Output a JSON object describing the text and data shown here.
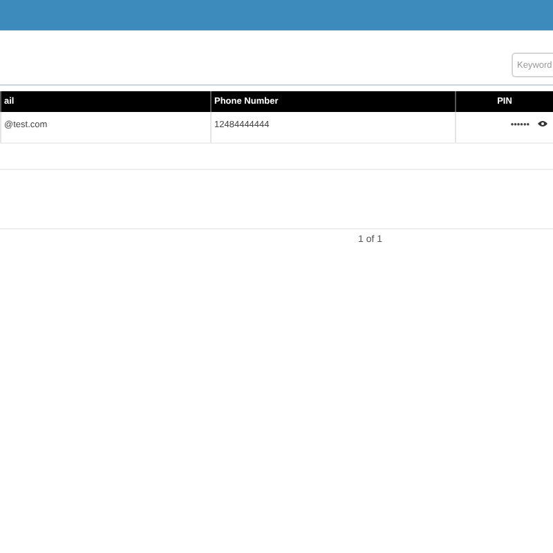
{
  "search": {
    "placeholder": "Keyword"
  },
  "table": {
    "columns": [
      "ail",
      "Phone Number",
      "PIN"
    ],
    "rows": [
      {
        "cells": [
          "@test.com",
          "12484444444",
          "••••••"
        ]
      }
    ]
  },
  "pagination": {
    "text": "1 of 1"
  }
}
